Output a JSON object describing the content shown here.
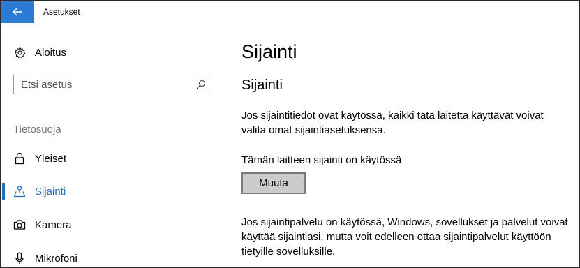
{
  "window": {
    "title": "Asetukset"
  },
  "sidebar": {
    "home_label": "Aloitus",
    "search_placeholder": "Etsi asetus",
    "section_label": "Tietosuoja",
    "items": [
      {
        "label": "Yleiset",
        "icon": "lock-icon",
        "selected": false
      },
      {
        "label": "Sijainti",
        "icon": "location-icon",
        "selected": true
      },
      {
        "label": "Kamera",
        "icon": "camera-icon",
        "selected": false
      },
      {
        "label": "Mikrofoni",
        "icon": "microphone-icon",
        "selected": false
      }
    ]
  },
  "main": {
    "page_title": "Sijainti",
    "section_title": "Sijainti",
    "description": "Jos sijaintitiedot ovat käytössä, kaikki tätä laitetta käyttävät voivat valita omat sijaintiasetuksensa.",
    "device_status": "Tämän laitteen sijainti on käytössä",
    "change_button": "Muuta",
    "service_description": "Jos sijaintipalvelu on käytössä, Windows, sovellukset ja palvelut voivat käyttää sijaintiasi, mutta voit edelleen ottaa sijaintipalvelut käyttöön tietyille sovelluksille."
  },
  "colors": {
    "accent": "#1f6fc4",
    "back_button": "#2b7bd4",
    "button_bg": "#cccccc"
  }
}
